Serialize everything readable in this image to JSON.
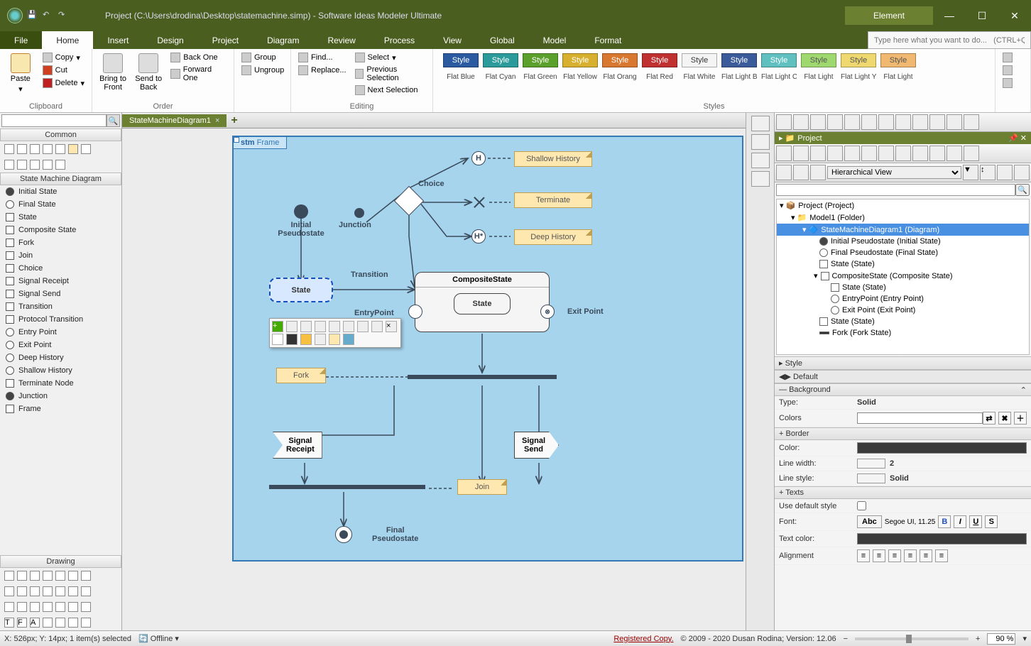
{
  "title": "Project (C:\\Users\\drodina\\Desktop\\statemachine.simp)  - Software Ideas Modeler Ultimate",
  "context_tab": "Element",
  "menu": {
    "file": "File",
    "home": "Home",
    "insert": "Insert",
    "design": "Design",
    "project": "Project",
    "diagram": "Diagram",
    "review": "Review",
    "process": "Process",
    "view": "View",
    "global": "Global",
    "model": "Model",
    "format": "Format",
    "search_hint": "Type here what you want to do...   (CTRL+Q)"
  },
  "ribbon": {
    "clipboard": {
      "label": "Clipboard",
      "paste": "Paste",
      "copy": "Copy",
      "cut": "Cut",
      "delete": "Delete"
    },
    "order": {
      "label": "Order",
      "bring_front": "Bring to\nFront",
      "send_back": "Send to\nBack",
      "back_one": "Back One",
      "forward_one": "Forward One"
    },
    "groups": {
      "group": "Group",
      "ungroup": "Ungroup"
    },
    "editing": {
      "label": "Editing",
      "find": "Find...",
      "replace": "Replace...",
      "select": "Select",
      "prev": "Previous Selection",
      "next": "Next Selection"
    },
    "styles_label": "Styles",
    "styles": [
      {
        "text": "Style",
        "name": "Flat Blue",
        "bg": "#2b5aa0",
        "fg": "#ffffff"
      },
      {
        "text": "Style",
        "name": "Flat Cyan",
        "bg": "#2a9a9a",
        "fg": "#ffffff"
      },
      {
        "text": "Style",
        "name": "Flat Green",
        "bg": "#5aa02b",
        "fg": "#ffffff"
      },
      {
        "text": "Style",
        "name": "Flat Yellow",
        "bg": "#d8b030",
        "fg": "#ffffff"
      },
      {
        "text": "Style",
        "name": "Flat Orang",
        "bg": "#d87830",
        "fg": "#ffffff"
      },
      {
        "text": "Style",
        "name": "Flat Red",
        "bg": "#c03030",
        "fg": "#ffffff"
      },
      {
        "text": "Style",
        "name": "Flat White",
        "bg": "#f4f4f4",
        "fg": "#333333"
      },
      {
        "text": "Style",
        "name": "Flat Light B",
        "bg": "#3a5a9a",
        "fg": "#ffffff"
      },
      {
        "text": "Style",
        "name": "Flat Light C",
        "bg": "#60c0c0",
        "fg": "#ffffff"
      },
      {
        "text": "Style",
        "name": "Flat Light",
        "bg": "#a0d870",
        "fg": "#555555"
      },
      {
        "text": "Style",
        "name": "Flat Light Y",
        "bg": "#f0d870",
        "fg": "#555555"
      },
      {
        "text": "Style",
        "name": "Flat Light",
        "bg": "#f0b870",
        "fg": "#555555"
      }
    ]
  },
  "left": {
    "common": "Common",
    "smd": "State Machine Diagram",
    "drawing": "Drawing",
    "tools": [
      "Initial State",
      "Final State",
      "State",
      "Composite State",
      "Fork",
      "Join",
      "Choice",
      "Signal Receipt",
      "Signal Send",
      "Transition",
      "Protocol Transition",
      "Entry Point",
      "Exit Point",
      "Deep History",
      "Shallow History",
      "Terminate Node",
      "Junction",
      "Frame"
    ]
  },
  "tab": {
    "name": "StateMachineDiagram1"
  },
  "diagram": {
    "frame_kw": "stm",
    "frame_name": "Frame",
    "initial": "Initial\nPseudostate",
    "junction": "Junction",
    "choice": "Choice",
    "shallow": "Shallow History",
    "terminate": "Terminate",
    "deep": "Deep History",
    "h": "H",
    "hstar": "H*",
    "state": "State",
    "transition": "Transition",
    "composite": "CompositeState",
    "inner_state": "State",
    "entry": "EntryPoint",
    "exit": "Exit Point",
    "fork": "Fork",
    "signal_receipt": "Signal\nReceipt",
    "signal_send": "Signal\nSend",
    "join": "Join",
    "final": "Final\nPseudostate"
  },
  "project_panel": {
    "title": "Project",
    "view": "Hierarchical View",
    "tree": {
      "root": "Project (Project)",
      "model": "Model1 (Folder)",
      "diagram": "StateMachineDiagram1 (Diagram)",
      "items": [
        "Initial Pseudostate (Initial State)",
        "Final Pseudostate (Final State)",
        "State (State)",
        "CompositeState (Composite State)",
        "State (State)",
        "EntryPoint (Entry Point)",
        "Exit Point (Exit Point)",
        "State (State)",
        "Fork (Fork State)"
      ]
    }
  },
  "style_panel": {
    "title": "Style",
    "default": "Default",
    "background": "Background",
    "type_l": "Type:",
    "type_v": "Solid",
    "colors_l": "Colors",
    "border": "Border",
    "color_l": "Color:",
    "lw_l": "Line width:",
    "lw_v": "2",
    "ls_l": "Line style:",
    "ls_v": "Solid",
    "texts": "Texts",
    "uds": "Use default style",
    "font_l": "Font:",
    "font_sample": "Abc",
    "font_v": "Segoe UI, 11.25",
    "tc_l": "Text color:",
    "align_l": "Alignment"
  },
  "status": {
    "pos": "X: 526px; Y: 14px; 1 item(s) selected",
    "offline": "Offline",
    "reg": "Registered Copy.",
    "copy": "© 2009 - 2020 Dusan Rodina; Version: 12.06",
    "zoom": "90 %"
  }
}
